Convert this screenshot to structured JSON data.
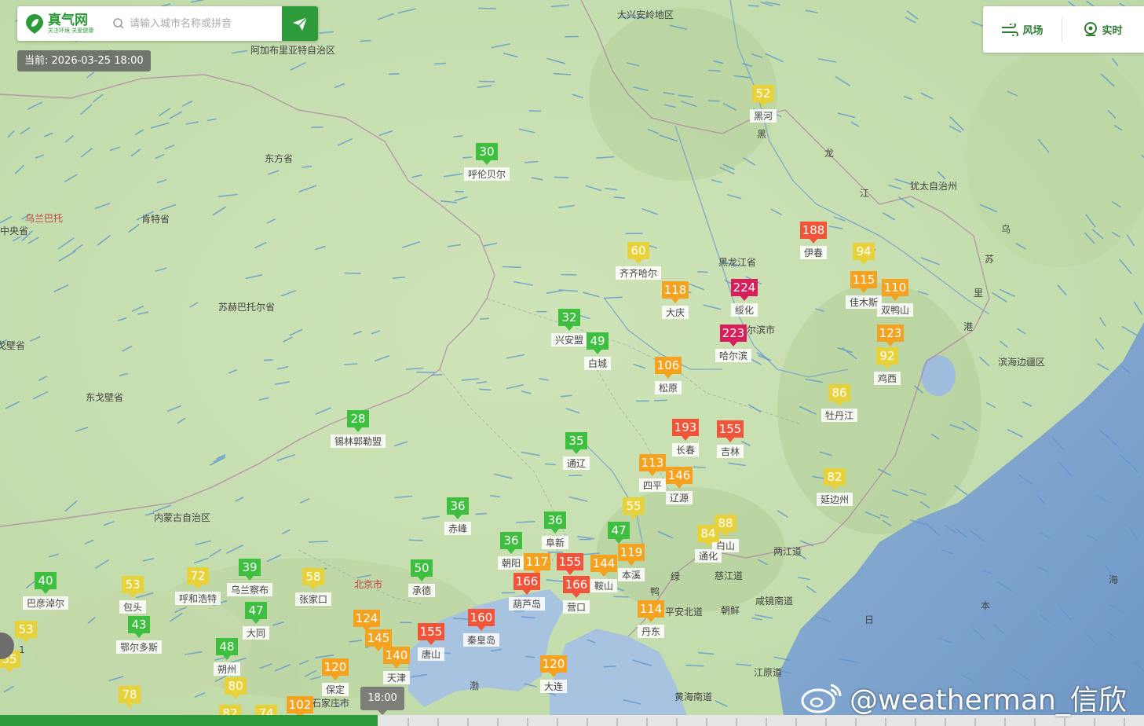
{
  "logo": {
    "name": "真气网",
    "slogan": "关注环境 关爱健康"
  },
  "search": {
    "placeholder": "请输入城市名称或拼音"
  },
  "current_time": "当前: 2026-03-25 18:00",
  "toolbar": {
    "wind_label": "风场",
    "live_label": "实时"
  },
  "timeline": {
    "thumb_label": "18:00",
    "progress_percent": 33
  },
  "watermark": "@weatherman_信欣",
  "colors": {
    "good": "#3fbf3f",
    "moderate": "#e8d23c",
    "light": "#f4a21f",
    "medium": "#f2543a",
    "heavy": "#d81e5b",
    "brand": "#2e9b3a"
  },
  "markers": [
    {
      "aqi": "52",
      "city": "黑河",
      "level": "moderate"
    },
    {
      "aqi": "30",
      "city": "呼伦贝尔",
      "level": "good"
    },
    {
      "aqi": "188",
      "city": "伊春",
      "level": "medium"
    },
    {
      "aqi": "94",
      "city": "",
      "level": "moderate"
    },
    {
      "aqi": "60",
      "city": "齐齐哈尔",
      "level": "moderate"
    },
    {
      "aqi": "224",
      "city": "绥化",
      "level": "heavy"
    },
    {
      "aqi": "118",
      "city": "大庆",
      "level": "light"
    },
    {
      "aqi": "115",
      "city": "佳木斯",
      "level": "light"
    },
    {
      "aqi": "110",
      "city": "双鸭山",
      "level": "light"
    },
    {
      "aqi": "32",
      "city": "兴安盟",
      "level": "good"
    },
    {
      "aqi": "223",
      "city": "哈尔滨",
      "level": "heavy"
    },
    {
      "aqi": "123",
      "city": "",
      "level": "light"
    },
    {
      "aqi": "49",
      "city": "白城",
      "level": "good"
    },
    {
      "aqi": "92",
      "city": "鸡西",
      "level": "moderate"
    },
    {
      "aqi": "106",
      "city": "松原",
      "level": "light"
    },
    {
      "aqi": "86",
      "city": "牡丹江",
      "level": "moderate"
    },
    {
      "aqi": "28",
      "city": "锡林郭勒盟",
      "level": "good"
    },
    {
      "aqi": "193",
      "city": "长春",
      "level": "medium"
    },
    {
      "aqi": "155",
      "city": "吉林",
      "level": "medium"
    },
    {
      "aqi": "35",
      "city": "通辽",
      "level": "good"
    },
    {
      "aqi": "113",
      "city": "四平",
      "level": "light"
    },
    {
      "aqi": "146",
      "city": "辽源",
      "level": "light"
    },
    {
      "aqi": "82",
      "city": "延边州",
      "level": "moderate"
    },
    {
      "aqi": "36",
      "city": "赤峰",
      "level": "good"
    },
    {
      "aqi": "55",
      "city": "",
      "level": "moderate"
    },
    {
      "aqi": "36",
      "city": "阜新",
      "level": "good"
    },
    {
      "aqi": "88",
      "city": "白山",
      "level": "moderate"
    },
    {
      "aqi": "47",
      "city": "",
      "level": "good"
    },
    {
      "aqi": "84",
      "city": "通化",
      "level": "moderate"
    },
    {
      "aqi": "36",
      "city": "朝阳",
      "level": "good"
    },
    {
      "aqi": "117",
      "city": "",
      "level": "light"
    },
    {
      "aqi": "155",
      "city": "",
      "level": "medium"
    },
    {
      "aqi": "144",
      "city": "鞍山",
      "level": "light"
    },
    {
      "aqi": "119",
      "city": "本溪",
      "level": "light"
    },
    {
      "aqi": "40",
      "city": "巴彦淖尔",
      "level": "good"
    },
    {
      "aqi": "72",
      "city": "呼和浩特",
      "level": "moderate"
    },
    {
      "aqi": "39",
      "city": "乌兰察布",
      "level": "good"
    },
    {
      "aqi": "58",
      "city": "张家口",
      "level": "moderate"
    },
    {
      "aqi": "50",
      "city": "承德",
      "level": "good"
    },
    {
      "aqi": "166",
      "city": "葫芦岛",
      "level": "medium"
    },
    {
      "aqi": "166",
      "city": "营口",
      "level": "medium"
    },
    {
      "aqi": "53",
      "city": "包头",
      "level": "moderate"
    },
    {
      "aqi": "47",
      "city": "大同",
      "level": "good"
    },
    {
      "aqi": "114",
      "city": "丹东",
      "level": "light"
    },
    {
      "aqi": "43",
      "city": "鄂尔多斯",
      "level": "good"
    },
    {
      "aqi": "124",
      "city": "",
      "level": "light"
    },
    {
      "aqi": "160",
      "city": "秦皇岛",
      "level": "medium"
    },
    {
      "aqi": "53",
      "city": "",
      "level": "moderate"
    },
    {
      "aqi": "145",
      "city": "",
      "level": "light"
    },
    {
      "aqi": "155",
      "city": "唐山",
      "level": "medium"
    },
    {
      "aqi": "48",
      "city": "朔州",
      "level": "good"
    },
    {
      "aqi": "140",
      "city": "天津",
      "level": "light"
    },
    {
      "aqi": "55",
      "city": "",
      "level": "moderate"
    },
    {
      "aqi": "120",
      "city": "保定",
      "level": "light"
    },
    {
      "aqi": "120",
      "city": "大连",
      "level": "light"
    },
    {
      "aqi": "80",
      "city": "",
      "level": "moderate"
    },
    {
      "aqi": "78",
      "city": "",
      "level": "moderate"
    },
    {
      "aqi": "102",
      "city": "",
      "level": "light"
    },
    {
      "aqi": "74",
      "city": "",
      "level": "moderate"
    },
    {
      "aqi": "82",
      "city": "",
      "level": "moderate"
    }
  ],
  "place_labels": [
    "大兴安岭地区",
    "阿加布里亚特自治区",
    "东方省",
    "肯特省",
    "乌兰巴托",
    "中央省",
    "苏赫巴托尔省",
    "戈壁省",
    "东戈壁省",
    "内蒙古自治区",
    "黑龙江省",
    "哈尔滨市",
    "犹太自治州",
    "滨海边疆区",
    "两江道",
    "慈江道",
    "咸镜南道",
    "平安北道",
    "朝鲜",
    "江原道",
    "黄海南道",
    "北京市",
    "石家庄市",
    "黑",
    "龙",
    "江",
    "乌",
    "苏",
    "里",
    "绿",
    "鸭",
    "海",
    "渤",
    "日",
    "本",
    "港",
    "1"
  ]
}
